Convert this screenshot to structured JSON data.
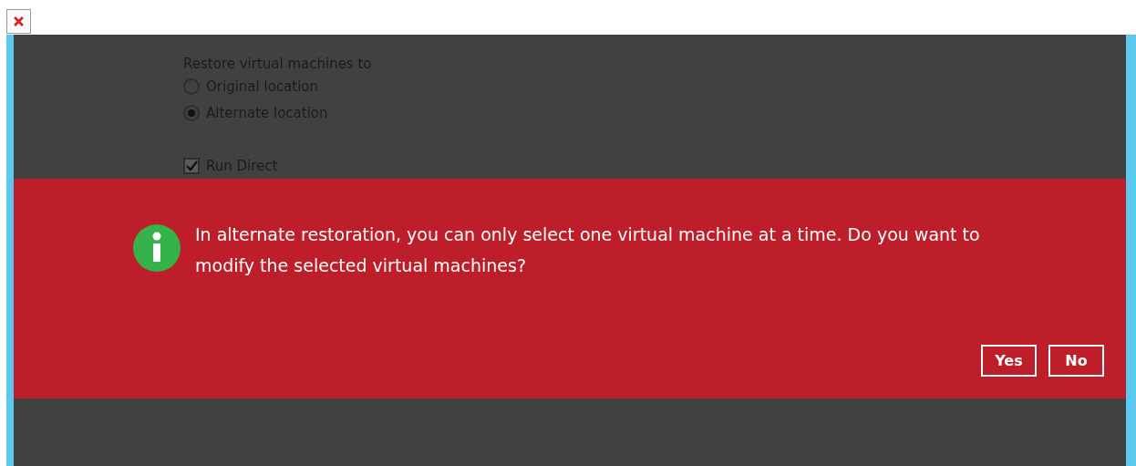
{
  "form": {
    "heading": "Restore virtual machines to",
    "options": [
      {
        "label": "Original location",
        "selected": false
      },
      {
        "label": "Alternate location",
        "selected": true
      }
    ],
    "run_direct": {
      "label": "Run Direct",
      "checked": true
    }
  },
  "dialog": {
    "message": "In alternate restoration, you can only select one virtual machine at a time. Do you want to modify the selected virtual machines?",
    "buttons": [
      "Yes",
      "No"
    ]
  }
}
